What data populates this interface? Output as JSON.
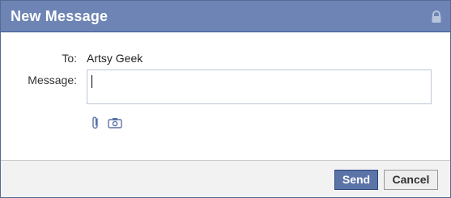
{
  "window": {
    "title": "New Message",
    "title_bar_color": "#6d84b4"
  },
  "form": {
    "to_label": "To:",
    "to_value": "Artsy Geek",
    "message_label": "Message:",
    "message_value": ""
  },
  "icons": {
    "lock": "lock-icon",
    "attach": "paperclip-icon",
    "photo": "camera-icon"
  },
  "buttons": {
    "send": "Send",
    "cancel": "Cancel",
    "send_color": "#5b74a8"
  }
}
